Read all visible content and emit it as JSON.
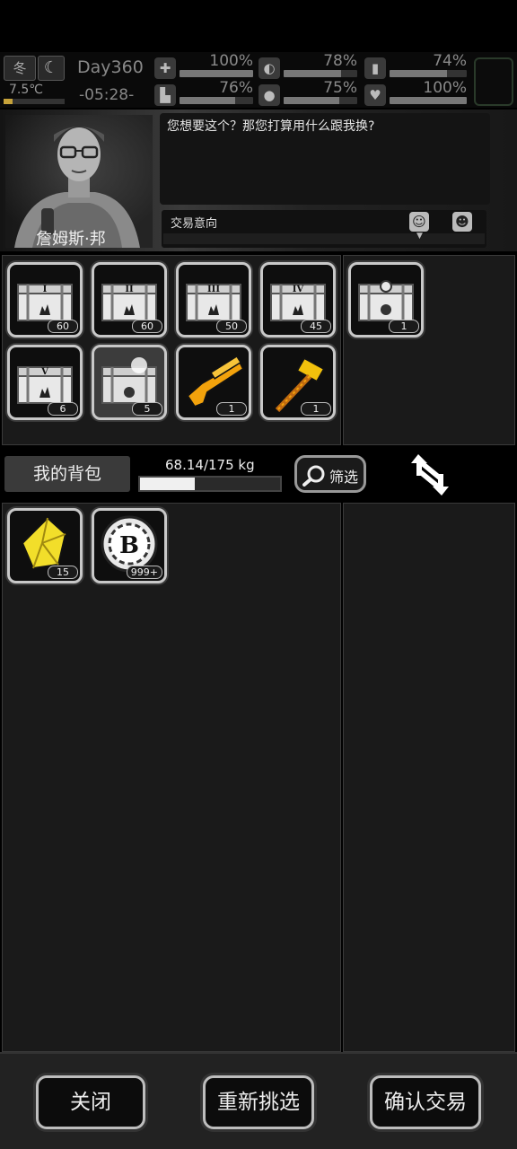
{
  "status": {
    "season": "冬",
    "temperature": "7.5℃",
    "day": "Day360",
    "time": "-05:28-",
    "stats": [
      {
        "name": "health",
        "icon": "medkit-icon",
        "glyph": "✚",
        "value": "100%",
        "fill": 1.0
      },
      {
        "name": "hunger",
        "icon": "stomach-icon",
        "glyph": "◐",
        "value": "78%",
        "fill": 0.78
      },
      {
        "name": "energy",
        "icon": "battery-icon",
        "glyph": "▮",
        "value": "74%",
        "fill": 0.74
      },
      {
        "name": "stamina",
        "icon": "boot-icon",
        "glyph": "▙",
        "value": "76%",
        "fill": 0.76
      },
      {
        "name": "thirst",
        "icon": "water-drop-icon",
        "glyph": "●",
        "value": "75%",
        "fill": 0.75
      },
      {
        "name": "mood",
        "icon": "heart-icon",
        "glyph": "♥",
        "value": "100%",
        "fill": 1.0
      }
    ]
  },
  "npc": {
    "name": "詹姆斯·邦",
    "dialog": "您想要这个？那您打算用什么跟我换?",
    "intent_label": "交易意向"
  },
  "trader_items": [
    {
      "name": "supply-crate-1",
      "numeral": "I",
      "count": "60"
    },
    {
      "name": "supply-crate-2",
      "numeral": "II",
      "count": "60"
    },
    {
      "name": "supply-crate-3",
      "numeral": "III",
      "count": "50"
    },
    {
      "name": "supply-crate-4",
      "numeral": "IV",
      "count": "45"
    },
    {
      "name": "supply-crate-5",
      "numeral": "V",
      "count": "6"
    },
    {
      "name": "special-crate",
      "numeral": "",
      "count": "5"
    },
    {
      "name": "golden-shotgun",
      "numeral": "",
      "count": "1"
    },
    {
      "name": "golden-hammer",
      "numeral": "",
      "count": "1"
    }
  ],
  "offer_items": [
    {
      "name": "special-crate-offered",
      "count": "1"
    }
  ],
  "backpack": {
    "tab_label": "我的背包",
    "weight": "68.14/175 kg",
    "weight_fill": 0.389,
    "filter_label": "筛选",
    "items": [
      {
        "name": "gold-crystal",
        "count": "15"
      },
      {
        "name": "b-coin",
        "count": "999+"
      }
    ]
  },
  "buttons": {
    "close": "关闭",
    "reselect": "重新挑选",
    "confirm": "确认交易"
  }
}
